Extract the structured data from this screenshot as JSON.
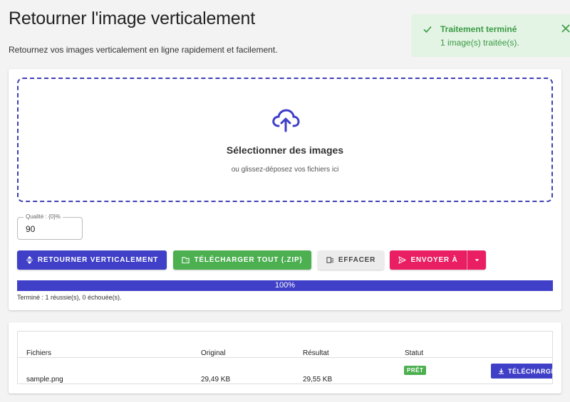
{
  "header": {
    "title": "Retourner l'image verticalement",
    "subtitle": "Retournez vos images verticalement en ligne rapidement et facilement."
  },
  "toast": {
    "title": "Traitement terminé",
    "message": "1 image(s) traitée(s).",
    "icon": "check-icon",
    "close_icon": "close-icon"
  },
  "dropzone": {
    "icon": "cloud-upload-icon",
    "title": "Sélectionner des images",
    "subtitle": "ou glissez-déposez vos fichiers ici"
  },
  "quality": {
    "label": "Qualité : {0}%",
    "value": "90"
  },
  "actions": {
    "flip": "RETOURNER VERTICALEMENT",
    "download_all": "TÉLÉCHARGER TOUT (.ZIP)",
    "clear": "EFFACER",
    "send_to": "ENVOYER À"
  },
  "progress": {
    "value_percent": 100,
    "label": "100%",
    "status": "Terminé : 1 réussie(s), 0 échouée(s)."
  },
  "files_table": {
    "columns": [
      "Fichiers",
      "Original",
      "Résultat",
      "Statut"
    ],
    "rows": [
      {
        "file": "sample.png",
        "original": "29,49 KB",
        "result": "29,55 KB",
        "status": "PRÊT",
        "action": "TÉLÉCHARGER"
      }
    ]
  },
  "colors": {
    "primary": "#3f3fc7",
    "success": "#4caf50",
    "accent": "#e91e63",
    "toast_bg": "#e3f3e4"
  }
}
